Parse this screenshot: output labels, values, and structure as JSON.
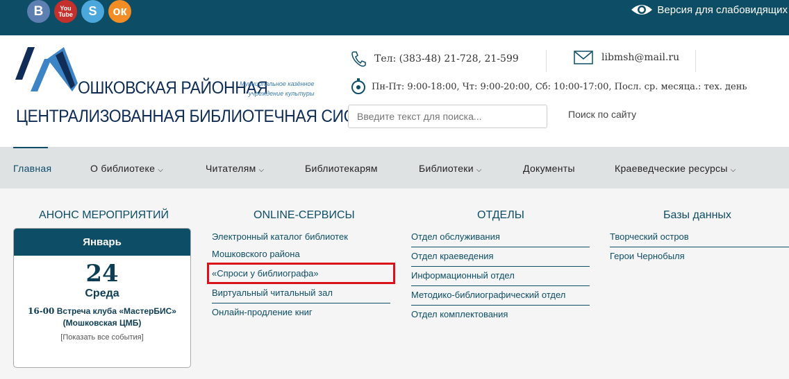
{
  "topbar": {
    "social": [
      {
        "name": "vk",
        "glyph": "В"
      },
      {
        "name": "youtube",
        "glyph_top": "You",
        "glyph_bottom": "Tube"
      },
      {
        "name": "skype",
        "glyph": "S"
      },
      {
        "name": "odnoklassniki",
        "glyph": "ок"
      }
    ],
    "vision_label": "Версия для слабовидящих"
  },
  "logo": {
    "line1": "ОШКОВСКАЯ РАЙОННАЯ",
    "line2": "ЦЕНТРАЛИЗОВАННАЯ БИБЛИОТЕЧНАЯ СИСТЕМА",
    "note_line1": "Муниципальное казённое",
    "note_line2": "учреждение культуры"
  },
  "contacts": {
    "phone": "Тел: (383-48) 21-728, 21-599",
    "email": "libmsh@mail.ru",
    "hours": "Пн-Пт: 9:00-18:00, Чт: 9:00-20:00, Сб: 10:00-17:00, Посл. ср. месяца.: тех. день"
  },
  "search": {
    "placeholder": "Введите текст для поиска...",
    "label": "Поиск по сайту"
  },
  "nav": {
    "items": [
      {
        "label": "Главная",
        "dropdown": false
      },
      {
        "label": "О библиотеке",
        "dropdown": true
      },
      {
        "label": "Читателям",
        "dropdown": true
      },
      {
        "label": "Библиотекарям",
        "dropdown": false
      },
      {
        "label": "Библиотеки",
        "dropdown": true
      },
      {
        "label": "Документы",
        "dropdown": false
      },
      {
        "label": "Краеведческие ресурсы",
        "dropdown": true
      }
    ]
  },
  "announce": {
    "title": "АНОНС МЕРОПРИЯТИЙ",
    "month": "Январь",
    "day": "24",
    "weekday": "Среда",
    "time": "16-00",
    "event_text": "Встреча клуба «МастерБИС»",
    "place": "(Мошковская ЦМБ)",
    "show_all": "[Показать все события]"
  },
  "online": {
    "title": "ONLINE-СЕРВИСЫ",
    "items": [
      "Электронный каталог библиотек",
      "Мошковского района",
      "«Спроси у библиографа»",
      "Виртуальный читальный зал",
      "Онлайн-продление книг"
    ]
  },
  "departments": {
    "title": "ОТДЕЛЫ",
    "items": [
      "Отдел обслуживания",
      "Отдел краеведения",
      "Информационный отдел",
      "Методико-библиографический отдел",
      "Отдел комплектования"
    ]
  },
  "databases": {
    "title": "Базы данных",
    "items": [
      "Творческий остров",
      "Герои Чернобыля"
    ]
  },
  "colors": {
    "primary": "#0d4d66",
    "highlight": "#d9121a"
  }
}
